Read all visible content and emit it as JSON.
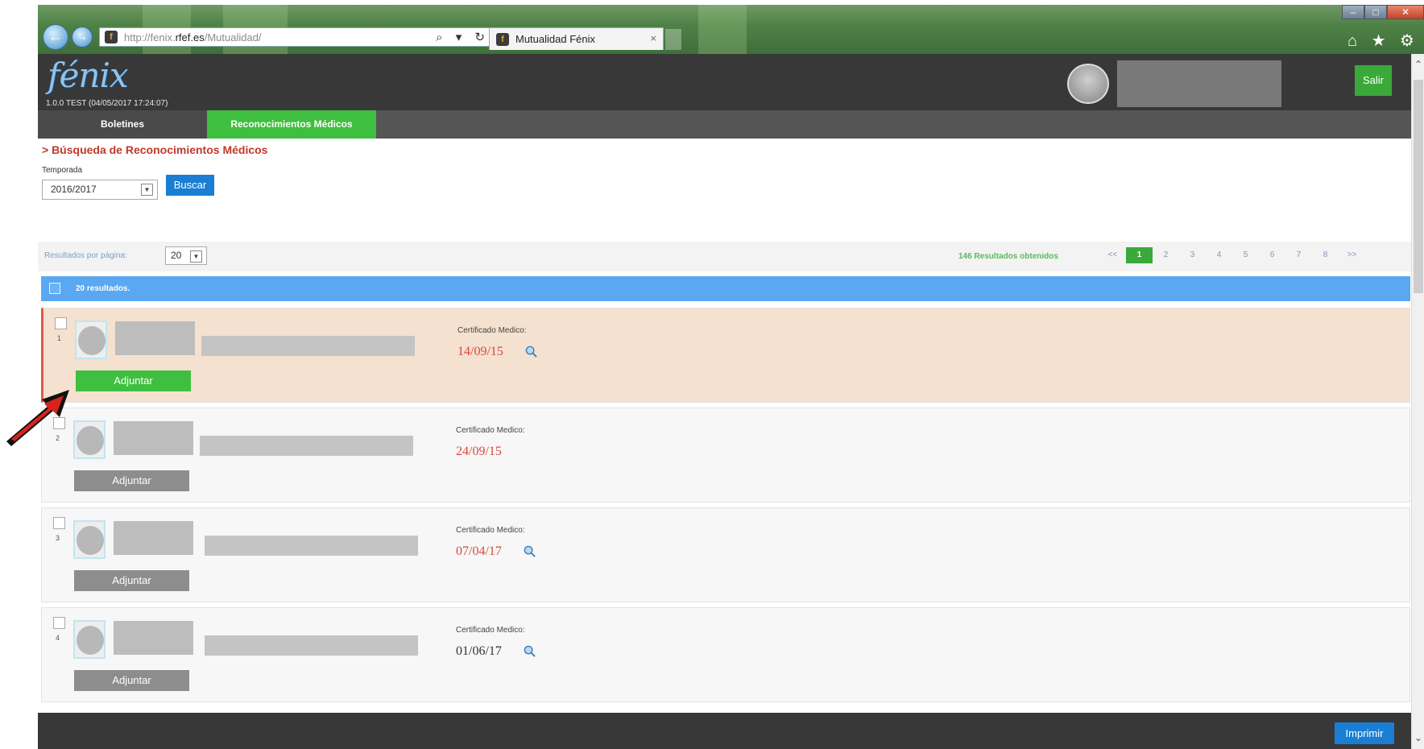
{
  "browser": {
    "url_prefix": "http://fenix.",
    "url_domain": "rfef.es",
    "url_path": "/Mutualidad/",
    "tab_title": "Mutualidad Fénix",
    "tab_close": "×",
    "address_icons": "⌕ ▾ ↻",
    "right_icons": "⌂ ★ ⚙"
  },
  "app": {
    "logo": "fénix",
    "version": "1.0.0 TEST (04/05/2017 17:24:07)",
    "logout_label": "Salir"
  },
  "nav": {
    "tabs": [
      {
        "label": "Boletines"
      },
      {
        "label": "Reconocimientos Médicos"
      }
    ]
  },
  "search": {
    "title": "> Búsqueda de Reconocimientos Médicos",
    "season_label": "Temporada",
    "season_value": "2016/2017",
    "button": "Buscar"
  },
  "results": {
    "per_page_label": "Resultados por página:",
    "per_page_value": "20",
    "count_label": "146 Resultados obtenidos",
    "pages": [
      "<<",
      "1",
      "2",
      "3",
      "4",
      "5",
      "6",
      "7",
      "8",
      ">>"
    ],
    "active_page": "1",
    "select_all_label": "20 resultados."
  },
  "records": [
    {
      "number": "1",
      "cert_label": "Certificado Medico:",
      "cert_date": "14/09/15",
      "attach_label": "Adjuntar",
      "highlight": true
    },
    {
      "number": "2",
      "cert_label": "Certificado Medico:",
      "cert_date": "24/09/15",
      "attach_label": "Adjuntar",
      "highlight": false
    },
    {
      "number": "3",
      "cert_label": "Certificado Medico:",
      "cert_date": "07/04/17",
      "attach_label": "Adjuntar",
      "highlight": false
    },
    {
      "number": "4",
      "cert_label": "Certificado Medico:",
      "cert_date": "01/06/17",
      "attach_label": "Adjuntar",
      "highlight": false
    }
  ],
  "footer": {
    "print_label": "Imprimir"
  },
  "colors": {
    "accent_green": "#3aa93a",
    "accent_blue": "#1a7fd4",
    "highlight_row": "#f5e1cf",
    "date_red": "#d9483b"
  }
}
